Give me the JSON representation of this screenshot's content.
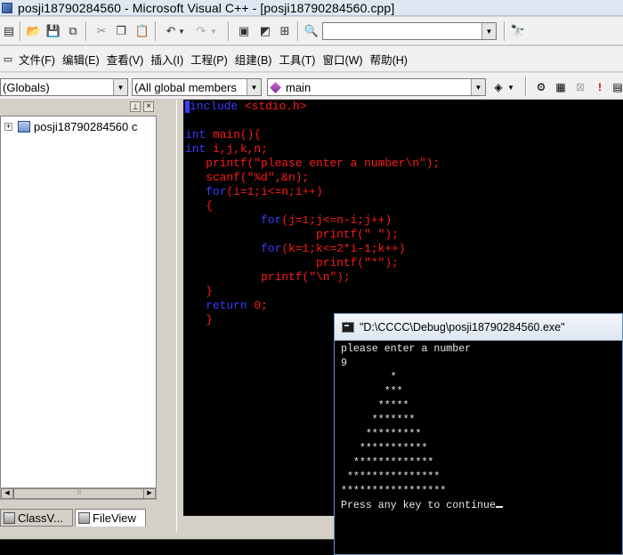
{
  "window": {
    "title": "posji18790284560 - Microsoft Visual C++ - [posji18790284560.cpp]"
  },
  "toolbar": {
    "find_value": "",
    "icons": [
      "new-icon",
      "open-icon",
      "save-icon",
      "save-all-icon",
      "cut-icon",
      "copy-icon",
      "paste-icon",
      "undo-icon",
      "redo-icon",
      "workspace-icon",
      "output-icon",
      "window-list-icon",
      "find-in-files-icon",
      "search-icon"
    ]
  },
  "menu": {
    "items": [
      "文件(F)",
      "编辑(E)",
      "查看(V)",
      "插入(I)",
      "工程(P)",
      "组建(B)",
      "工具(T)",
      "窗口(W)",
      "帮助(H)"
    ]
  },
  "wizardbar": {
    "scope": "(Globals)",
    "members": "(All global members",
    "function": "main"
  },
  "workspace": {
    "project": "posji18790284560 c",
    "tabs": [
      "ClassV...",
      "FileView"
    ],
    "pin_glyph": "⊥",
    "close_glyph": "×"
  },
  "editor": {
    "lines": [
      [
        {
          "t": "#include <stdio.h>",
          "c": "pre"
        }
      ],
      [],
      [
        {
          "t": "int",
          "c": "kw"
        },
        {
          "t": " main(){"
        }
      ],
      [
        {
          "t": "int",
          "c": "kw"
        },
        {
          "t": " i,j,k,n;"
        }
      ],
      [
        {
          "t": "   printf(\"please enter a number\\n\");"
        }
      ],
      [
        {
          "t": "   scanf(\"%d\",&n);"
        }
      ],
      [
        {
          "t": "   "
        },
        {
          "t": "for",
          "c": "kw"
        },
        {
          "t": "(i=1;i<=n;i++)"
        }
      ],
      [
        {
          "t": "   {"
        }
      ],
      [
        {
          "t": "           "
        },
        {
          "t": "for",
          "c": "kw"
        },
        {
          "t": "(j=1;j<=n-i;j++)"
        }
      ],
      [
        {
          "t": "                   printf(\" \");"
        }
      ],
      [
        {
          "t": "           "
        },
        {
          "t": "for",
          "c": "kw"
        },
        {
          "t": "(k=1;k<=2*i-1;k++)"
        }
      ],
      [
        {
          "t": "                   printf(\"*\");"
        }
      ],
      [
        {
          "t": "           printf(\"\\n\");"
        }
      ],
      [
        {
          "t": "   }"
        }
      ],
      [
        {
          "t": "   "
        },
        {
          "t": "return",
          "c": "kw"
        },
        {
          "t": " 0;"
        }
      ],
      [
        {
          "t": "   }"
        }
      ]
    ]
  },
  "console": {
    "title": "\"D:\\CCCC\\Debug\\posji18790284560.exe\"",
    "lines": [
      "please enter a number",
      "9",
      "        *",
      "       ***",
      "      *****",
      "     *******",
      "    *********",
      "   ***********",
      "  *************",
      " ***************",
      "*****************",
      "Press any key to continue"
    ]
  }
}
